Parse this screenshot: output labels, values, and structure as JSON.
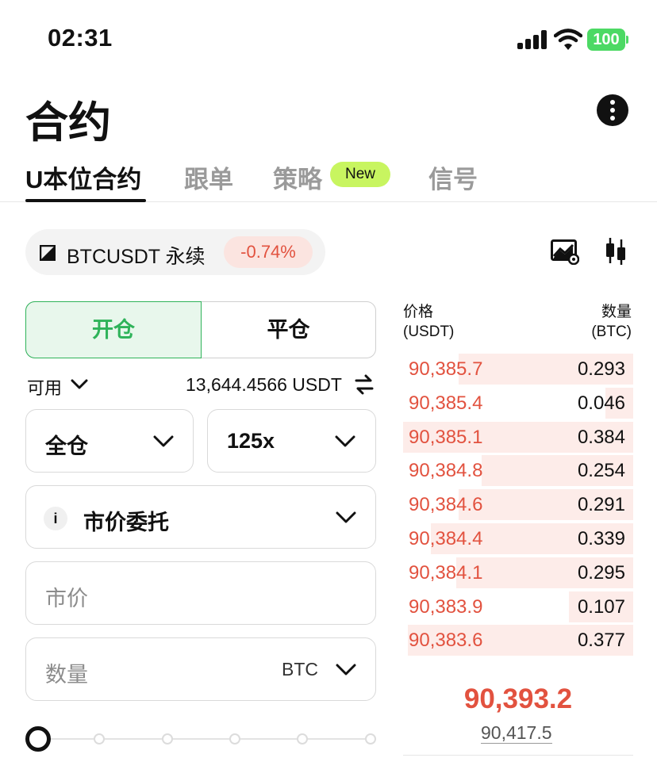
{
  "status_bar": {
    "time": "02:31",
    "battery": "100"
  },
  "header": {
    "title": "合约"
  },
  "tabs": [
    {
      "label": "U本位合约"
    },
    {
      "label": "跟单"
    },
    {
      "label": "策略",
      "badge": "New"
    },
    {
      "label": "信号"
    }
  ],
  "pair": {
    "name": "BTCUSDT 永续",
    "change": "-0.74%"
  },
  "order_side": {
    "open": "开仓",
    "close": "平仓"
  },
  "available": {
    "label": "可用",
    "value": "13,644.4566 USDT"
  },
  "margin_mode": {
    "value": "全仓"
  },
  "leverage": {
    "value": "125x"
  },
  "order_type": {
    "info": "i",
    "value": "市价委托"
  },
  "price_field": {
    "placeholder": "市价"
  },
  "quantity_field": {
    "placeholder": "数量",
    "unit": "BTC"
  },
  "orderbook": {
    "price_header": [
      "价格",
      "(USDT)"
    ],
    "qty_header": [
      "数量",
      "(BTC)"
    ],
    "asks": [
      {
        "price": "90,385.7",
        "qty": "0.293",
        "depth": 0.76
      },
      {
        "price": "90,385.4",
        "qty": "0.046",
        "depth": 0.12
      },
      {
        "price": "90,385.1",
        "qty": "0.384",
        "depth": 1.0
      },
      {
        "price": "90,384.8",
        "qty": "0.254",
        "depth": 0.66
      },
      {
        "price": "90,384.6",
        "qty": "0.291",
        "depth": 0.76
      },
      {
        "price": "90,384.4",
        "qty": "0.339",
        "depth": 0.88
      },
      {
        "price": "90,384.1",
        "qty": "0.295",
        "depth": 0.77
      },
      {
        "price": "90,383.9",
        "qty": "0.107",
        "depth": 0.28
      },
      {
        "price": "90,383.6",
        "qty": "0.377",
        "depth": 0.98
      }
    ],
    "last_price": "90,393.2",
    "mark_price": "90,417.5"
  },
  "colors": {
    "up": "#2fb35a",
    "down": "#e2523f",
    "badge": "#c8f560",
    "battery": "#4cd964"
  }
}
